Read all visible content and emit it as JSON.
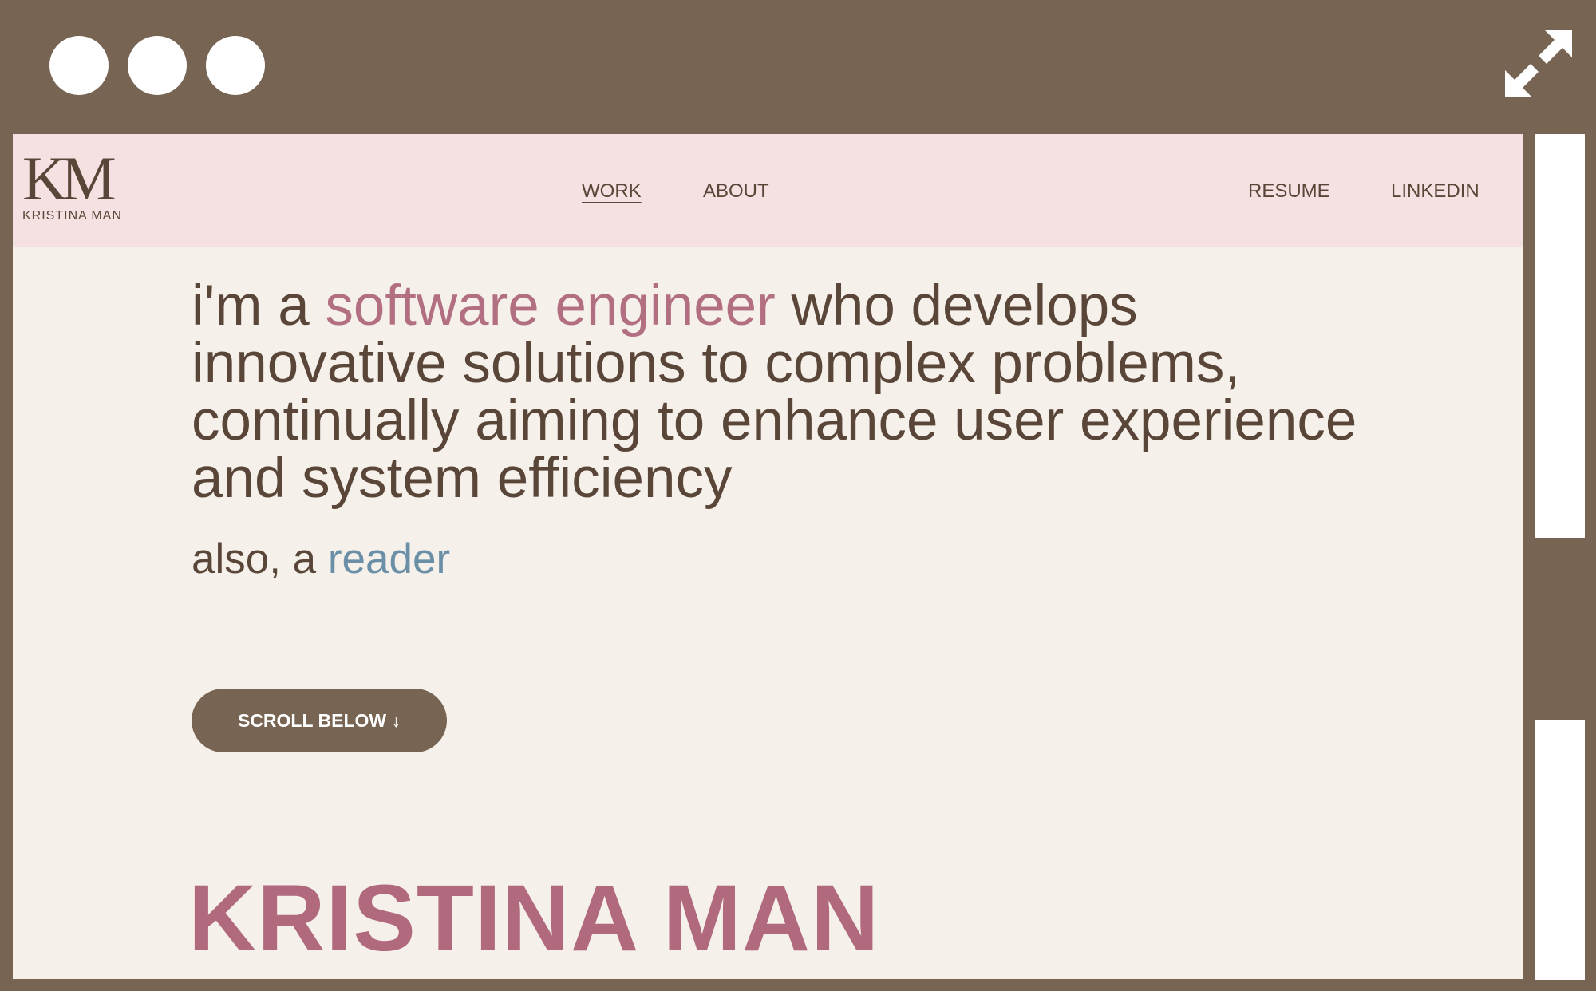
{
  "window": {
    "controls": [
      "window-dot",
      "window-dot",
      "window-dot"
    ],
    "expand_icon": "expand-arrows-icon",
    "frame_color": "#776453"
  },
  "nav": {
    "logo_mark": "KM",
    "logo_name": "KRISTINA MAN",
    "left_links": [
      "WORK",
      "ABOUT"
    ],
    "active_link": "WORK",
    "right_links": [
      "RESUME",
      "LINKEDIN"
    ],
    "background": "#f5e1e2"
  },
  "hero": {
    "intro_prefix": "i'm a ",
    "role": "software engineer",
    "intro_rest": " who develops innovative solutions to complex problems, continually aiming to enhance user experience and system efficiency",
    "also_prefix": "also, a ",
    "hobby": "reader",
    "accent_color": "#b36f82",
    "hobby_color": "#6a8fa6"
  },
  "cta": {
    "scroll_label": "SCROLL BELOW ↓"
  },
  "name_heading": "KRISTINA MAN",
  "page_background": "#f5f0ea"
}
